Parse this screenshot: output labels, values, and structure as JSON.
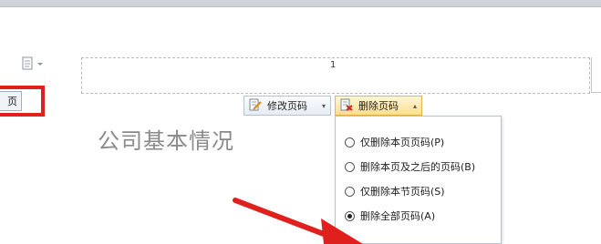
{
  "header": {
    "page_number": "1"
  },
  "left_tab": {
    "label": "页眉"
  },
  "toolbar": {
    "modify_label": "修改页码",
    "delete_label": "删除页码"
  },
  "document": {
    "heading": "公司基本情况"
  },
  "delete_menu": {
    "options": [
      {
        "label": "仅删除本页页码(P)",
        "checked": false
      },
      {
        "label": "删除本页及之后的页码(B)",
        "checked": false
      },
      {
        "label": "仅删除本节页码(S)",
        "checked": false
      },
      {
        "label": "删除全部页码(A)",
        "checked": true
      }
    ]
  },
  "colors": {
    "annotation_red": "#e0201c",
    "heading_gray": "#8a8a8a",
    "active_button": "#ffdf8e"
  }
}
